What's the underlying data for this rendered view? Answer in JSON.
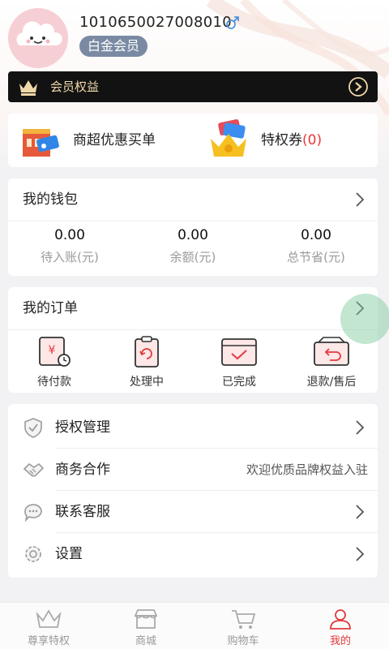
{
  "profile": {
    "username": "1010650027008010",
    "gender_symbol": "♂",
    "level": "白金会员"
  },
  "member_bar": {
    "label": "会员权益"
  },
  "quick": [
    {
      "label": "商超优惠买单",
      "icon": "supermarket-icon"
    },
    {
      "label": "特权券",
      "count": "(0)",
      "icon": "coupon-crown-icon"
    }
  ],
  "wallet": {
    "title": "我的钱包",
    "items": [
      {
        "value": "0.00",
        "label": "待入账(元)"
      },
      {
        "value": "0.00",
        "label": "余额(元)"
      },
      {
        "value": "0.00",
        "label": "总节省(元)"
      }
    ]
  },
  "orders": {
    "title": "我的订单",
    "items": [
      {
        "label": "待付款",
        "icon": "pending-payment-icon"
      },
      {
        "label": "处理中",
        "icon": "processing-icon"
      },
      {
        "label": "已完成",
        "icon": "completed-icon"
      },
      {
        "label": "退款/售后",
        "icon": "refund-icon"
      }
    ]
  },
  "menu": [
    {
      "label": "授权管理",
      "icon": "shield-check-icon",
      "note": ""
    },
    {
      "label": "商务合作",
      "icon": "handshake-icon",
      "note": "欢迎优质品牌权益入驻"
    },
    {
      "label": "联系客服",
      "icon": "chat-icon",
      "note": ""
    },
    {
      "label": "设置",
      "icon": "gear-icon",
      "note": ""
    }
  ],
  "tabs": [
    {
      "label": "尊享特权",
      "icon": "crown-tab-icon",
      "active": false
    },
    {
      "label": "商城",
      "icon": "store-icon",
      "active": false
    },
    {
      "label": "购物车",
      "icon": "cart-icon",
      "active": false
    },
    {
      "label": "我的",
      "icon": "person-icon",
      "active": true
    }
  ],
  "colors": {
    "accent_red": "#e4393c",
    "badge_bg": "#7a8aa3",
    "member_bar_bg": "#121212",
    "member_gold": "#f0d9a8"
  }
}
